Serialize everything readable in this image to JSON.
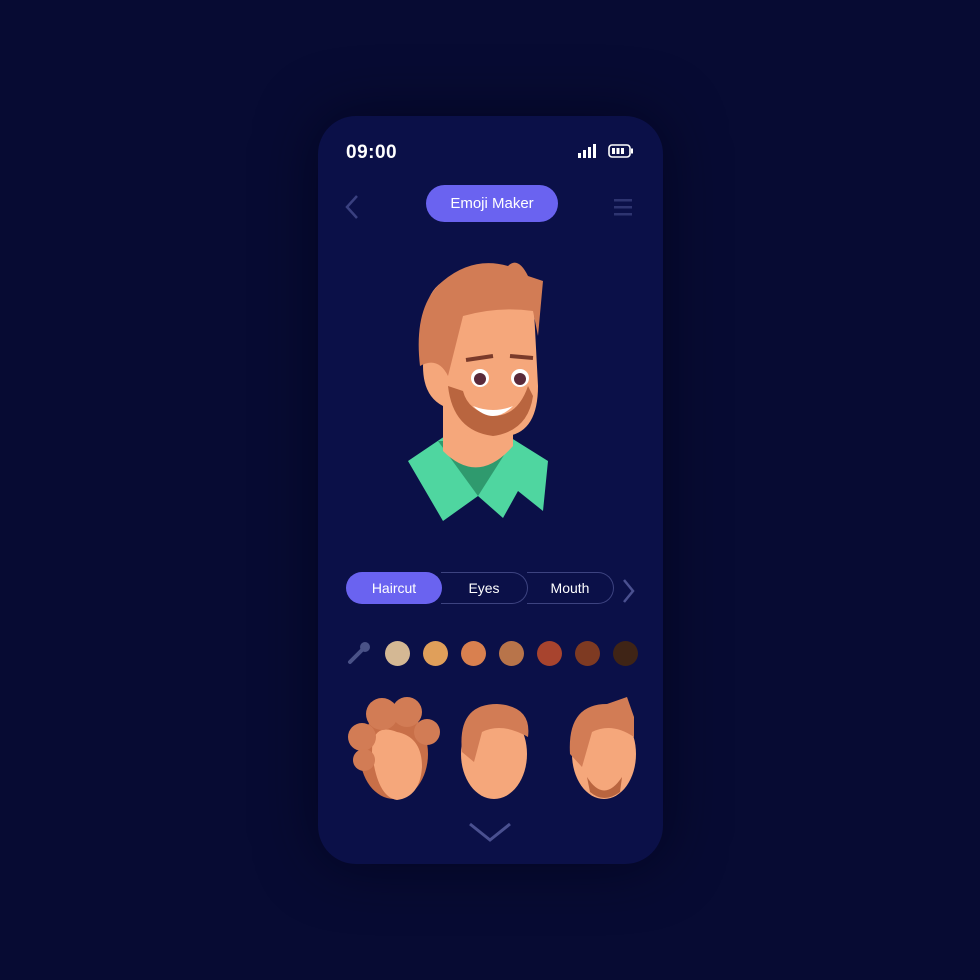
{
  "status": {
    "time": "09:00",
    "signal_icon": "signal-icon",
    "battery_icon": "battery-icon"
  },
  "header": {
    "title": "Emoji Maker",
    "back_icon": "chevron-left-icon",
    "menu_icon": "menu-icon"
  },
  "tabs": [
    {
      "label": "Haircut",
      "active": true
    },
    {
      "label": "Eyes",
      "active": false
    },
    {
      "label": "Mouth",
      "active": false
    }
  ],
  "colors": {
    "accent": "#6a63f0",
    "background": "#0b1048",
    "swatches": [
      "#d4b894",
      "#e09f5a",
      "#d9804f",
      "#b8744a",
      "#a8442e",
      "#7e3a22",
      "#3f2416"
    ]
  },
  "haircut_options": [
    "curly",
    "short",
    "short-with-beard"
  ]
}
